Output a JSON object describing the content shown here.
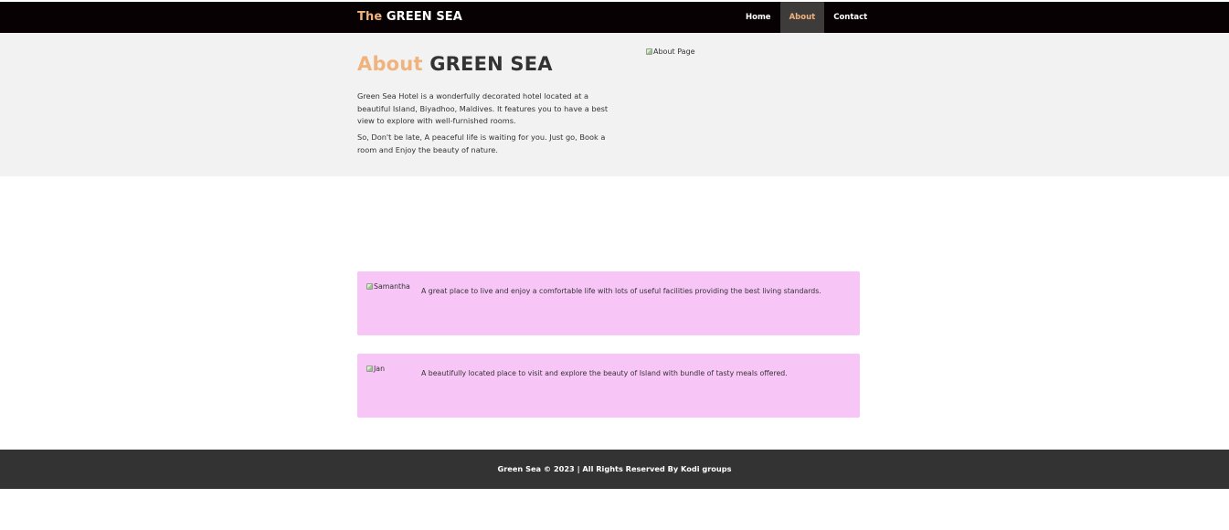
{
  "navbar": {
    "brand_prefix": "The",
    "brand_name": "GREEN SEA",
    "links": [
      {
        "label": "Home"
      },
      {
        "label": "About"
      },
      {
        "label": "Contact"
      }
    ],
    "active_link": "About"
  },
  "about": {
    "heading_accent": "About",
    "heading_rest": "GREEN SEA",
    "paragraph_1": "Green Sea Hotel is a wonderfully decorated hotel located at a beautiful Island, Biyadhoo, Maldives. It features you to have a best view to explore with well-furnished rooms.",
    "paragraph_2": "So, Don't be late, A peaceful life is waiting for you. Just go, Book a room and Enjoy the beauty of nature.",
    "image_alt": "About Page"
  },
  "testimonials": [
    {
      "name": "Samantha",
      "quote": "A great place to live and enjoy a comfortable life with lots of useful facilities providing the best living standards."
    },
    {
      "name": "Jan",
      "quote": "A beautifully located place to visit and explore the beauty of Island with bundle of tasty meals offered."
    }
  ],
  "footer": {
    "text": "Green Sea © 2023 | All Rights Reserved By Kodi groups"
  },
  "colors": {
    "navbar_bg": "#070103",
    "accent": "#f0b37e",
    "active_tab_bg": "#3e3b3b",
    "about_bg": "#f2f2f2",
    "testimonial_bg": "#f7c6f7",
    "footer_bg": "#333333"
  }
}
